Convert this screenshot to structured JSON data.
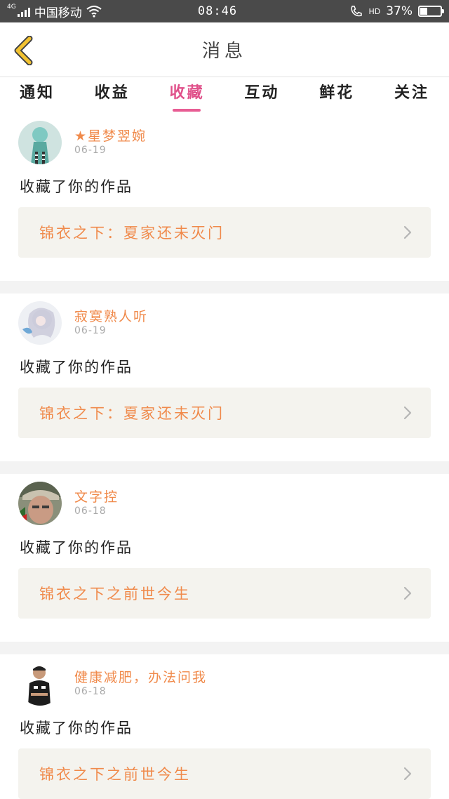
{
  "status_bar": {
    "network": "4G",
    "carrier": "中国移动",
    "time": "08:46",
    "hd": "HD",
    "battery_text": "37%",
    "battery_level": 0.37
  },
  "nav": {
    "title": "消息",
    "back_icon": "chevron-left-icon"
  },
  "tabs": [
    {
      "label": "通知",
      "active": false
    },
    {
      "label": "收益",
      "active": false
    },
    {
      "label": "收藏",
      "active": true
    },
    {
      "label": "互动",
      "active": false
    },
    {
      "label": "鲜花",
      "active": false
    },
    {
      "label": "关注",
      "active": false
    }
  ],
  "messages": [
    {
      "username": "★星梦翌婉",
      "date": "06-19",
      "action": "收藏了你的作品",
      "work": "锦衣之下：夏家还未灭门"
    },
    {
      "username": "寂寞熟人听",
      "date": "06-19",
      "action": "收藏了你的作品",
      "work": "锦衣之下：夏家还未灭门"
    },
    {
      "username": "文字控",
      "date": "06-18",
      "action": "收藏了你的作品",
      "work": "锦衣之下之前世今生"
    },
    {
      "username": "健康减肥，办法问我",
      "date": "06-18",
      "action": "收藏了你的作品",
      "work": "锦衣之下之前世今生"
    }
  ],
  "colors": {
    "accent": "#e0508a",
    "name": "#f08a4b",
    "back_arrow": "#f2c230"
  }
}
